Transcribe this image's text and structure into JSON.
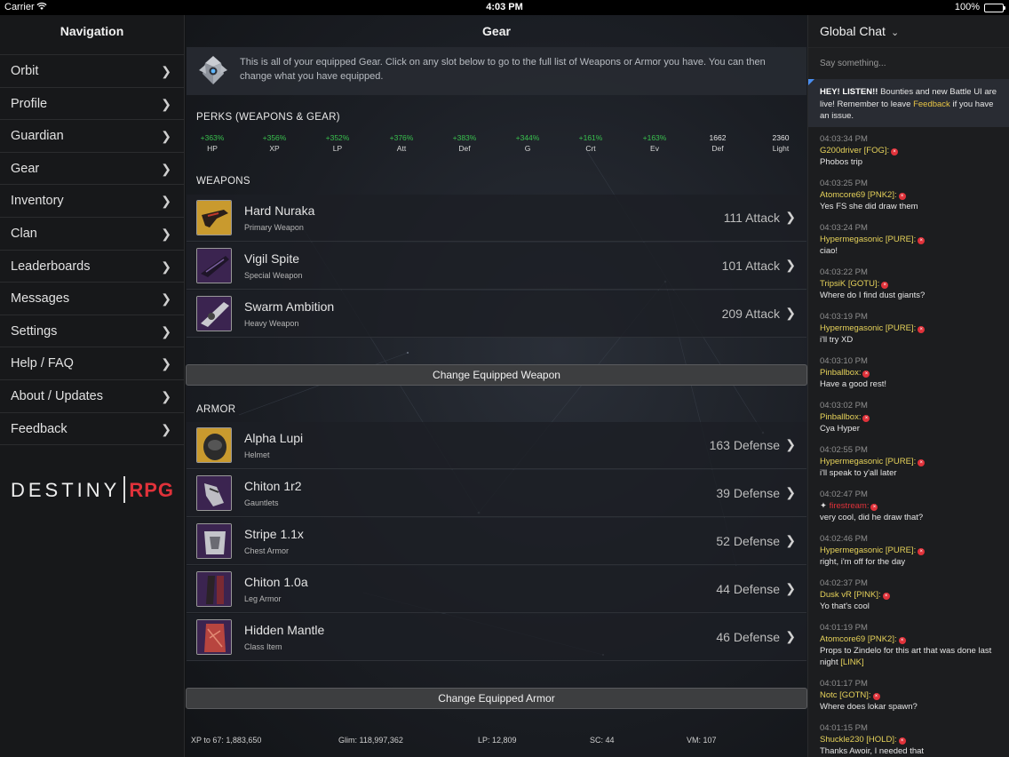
{
  "status_bar": {
    "carrier": "Carrier",
    "time": "4:03 PM",
    "battery": "100%"
  },
  "nav": {
    "title": "Navigation",
    "items": [
      {
        "label": "Orbit"
      },
      {
        "label": "Profile"
      },
      {
        "label": "Guardian"
      },
      {
        "label": "Gear"
      },
      {
        "label": "Inventory"
      },
      {
        "label": "Clan"
      },
      {
        "label": "Leaderboards"
      },
      {
        "label": "Messages"
      },
      {
        "label": "Settings"
      },
      {
        "label": "Help / FAQ"
      },
      {
        "label": "About / Updates"
      },
      {
        "label": "Feedback"
      }
    ],
    "logo": {
      "word1": "DESTINY",
      "word2": "RPG"
    }
  },
  "gear": {
    "title": "Gear",
    "intro": "This is all of your equipped Gear. Click on any slot below to go to the full list of Weapons or Armor you have. You can then change what you have equipped.",
    "perks_title": "PERKS (WEAPONS & GEAR)",
    "perks": [
      {
        "value": "+363%",
        "label": "HP"
      },
      {
        "value": "+356%",
        "label": "XP"
      },
      {
        "value": "+352%",
        "label": "LP"
      },
      {
        "value": "+376%",
        "label": "Att"
      },
      {
        "value": "+383%",
        "label": "Def"
      },
      {
        "value": "+344%",
        "label": "G"
      },
      {
        "value": "+161%",
        "label": "Crt"
      },
      {
        "value": "+163%",
        "label": "Ev"
      },
      {
        "value": "1662",
        "label": "Def"
      },
      {
        "value": "2360",
        "label": "Light"
      }
    ],
    "weapons_title": "WEAPONS",
    "weapons": [
      {
        "name": "Hard Nuraka",
        "type": "Primary Weapon",
        "stat": "111 Attack"
      },
      {
        "name": "Vigil Spite",
        "type": "Special Weapon",
        "stat": "101 Attack"
      },
      {
        "name": "Swarm Ambition",
        "type": "Heavy Weapon",
        "stat": "209 Attack"
      }
    ],
    "change_weapon_label": "Change Equipped Weapon",
    "armor_title": "ARMOR",
    "armor": [
      {
        "name": "Alpha Lupi",
        "type": "Helmet",
        "stat": "163 Defense"
      },
      {
        "name": "Chiton 1r2",
        "type": "Gauntlets",
        "stat": "39 Defense"
      },
      {
        "name": "Stripe 1.1x",
        "type": "Chest Armor",
        "stat": "52 Defense"
      },
      {
        "name": "Chiton 1.0a",
        "type": "Leg Armor",
        "stat": "44 Defense"
      },
      {
        "name": "Hidden Mantle",
        "type": "Class Item",
        "stat": "46 Defense"
      }
    ],
    "change_armor_label": "Change Equipped Armor",
    "footer": {
      "xp": "XP to 67: 1,883,650",
      "glim": "Glim: 118,997,362",
      "lp": "LP: 12,809",
      "sc": "SC: 44",
      "vm": "VM: 107"
    }
  },
  "chat": {
    "title": "Global Chat",
    "placeholder": "Say something...",
    "notice": {
      "bold": "HEY! LISTEN!!",
      "text": " Bounties and new Battle UI are live! Remember to leave ",
      "link": "Feedback",
      "tail": " if you have an issue."
    },
    "messages": [
      {
        "time": "04:03:34 PM",
        "user": "G200driver [FOG]:",
        "text": "Phobos trip"
      },
      {
        "time": "04:03:25 PM",
        "user": "Atomcore69 [PNK2]:",
        "text": "Yes FS she did draw them"
      },
      {
        "time": "04:03:24 PM",
        "user": "Hypermegasonic [PURE]:",
        "text": "ciao!"
      },
      {
        "time": "04:03:22 PM",
        "user": "TripsiK [GOTU]:",
        "text": "Where do I find dust giants?"
      },
      {
        "time": "04:03:19 PM",
        "user": "Hypermegasonic [PURE]:",
        "text": "i'll try XD"
      },
      {
        "time": "04:03:10 PM",
        "user": "Pinballbox:",
        "text": "Have a good rest!"
      },
      {
        "time": "04:03:02 PM",
        "user": "Pinballbox:",
        "text": "Cya Hyper"
      },
      {
        "time": "04:02:55 PM",
        "user": "Hypermegasonic [PURE]:",
        "text": "i'll speak to y'all later"
      },
      {
        "time": "04:02:47 PM",
        "user": "firestream:",
        "text": "very cool, did he draw that?"
      },
      {
        "time": "04:02:46 PM",
        "user": "Hypermegasonic [PURE]:",
        "text": "right, i'm off for the day"
      },
      {
        "time": "04:02:37 PM",
        "user": "Dusk vR [PINK]:",
        "text": "Yo that's cool"
      },
      {
        "time": "04:01:19 PM",
        "user": "Atomcore69 [PNK2]:",
        "text": "Props to Zindelo for this art that was done last night",
        "link": "[LINK]"
      },
      {
        "time": "04:01:17 PM",
        "user": "Notc [GOTN]:",
        "text": "Where does lokar spawn?"
      },
      {
        "time": "04:01:15 PM",
        "user": "Shuckle230 [HOLD]:",
        "text": "Thanks Awoir, I needed that"
      }
    ]
  }
}
